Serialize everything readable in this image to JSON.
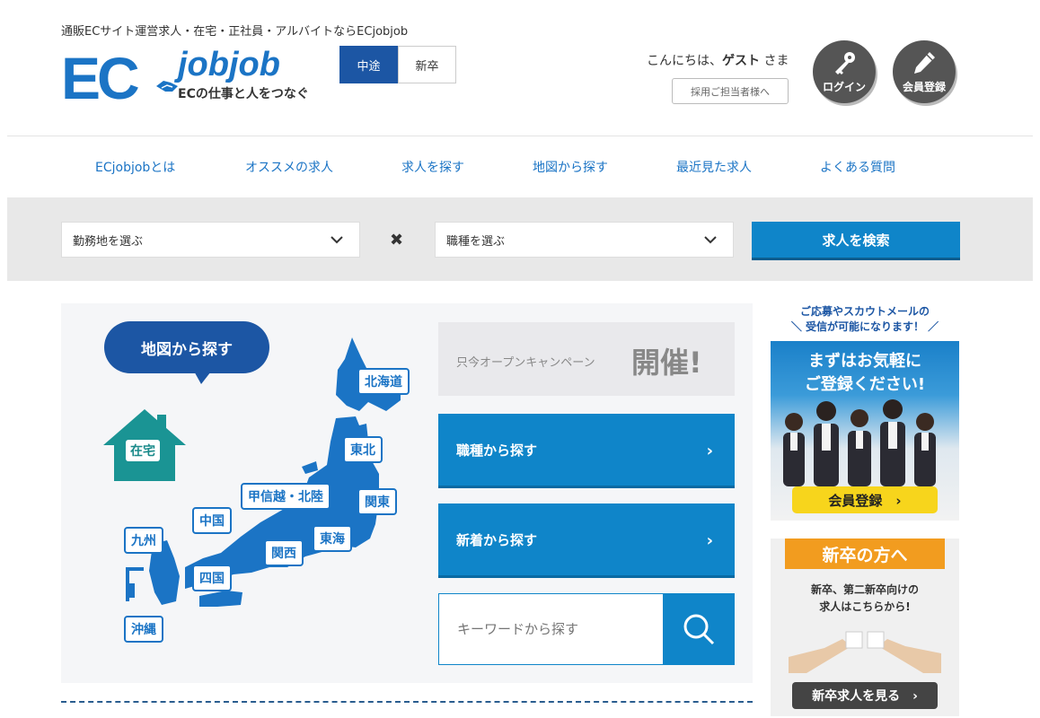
{
  "header": {
    "tagline": "通販ECサイト運営求人・在宅・正社員・アルバイトならECjobjob",
    "logo_ec": "EC",
    "logo_jobjob": "jobjob",
    "logo_sub": "ECの仕事と人をつなぐ",
    "segments": [
      "中途",
      "新卒"
    ],
    "greeting_prefix": "こんにちは、",
    "greeting_user": "ゲスト",
    "greeting_suffix": " さま",
    "recruiter_link": "採用ご担当者様へ",
    "login_label": "ログイン",
    "register_label": "会員登録"
  },
  "nav": {
    "items": [
      "ECjobjobとは",
      "オススメの求人",
      "求人を探す",
      "地図から探す",
      "最近見た求人",
      "よくある質問"
    ]
  },
  "search": {
    "location_select": "勤務地を選ぶ",
    "times": "✖",
    "job_select": "職種を選ぶ",
    "button": "求人を検索"
  },
  "map": {
    "bubble": "地図から探す",
    "home": "在宅",
    "regions": [
      "北海道",
      "東北",
      "甲信越・北陸",
      "関東",
      "中国",
      "東海",
      "九州",
      "関西",
      "四国",
      "沖縄"
    ]
  },
  "main": {
    "campaign_small": "只今オープンキャンペーン",
    "campaign_big": "開催!",
    "by_job": "職種から探す",
    "by_new": "新着から探す",
    "keyword_placeholder": "キーワードから探す",
    "arrow": "›"
  },
  "sidebar": {
    "note_line1": "ご応募やスカウトメールの",
    "note_line2": "＼ 受信が可能になります！ ／",
    "banner1_line1": "まずはお気軽に",
    "banner1_line2": "ご登録ください!",
    "banner1_button": "会員登録　›",
    "banner2_ribbon": "新卒の方へ",
    "banner2_line1": "新卒、第二新卒向けの",
    "banner2_line2": "求人はこちらから!",
    "banner2_button": "新卒求人を見る　›"
  },
  "colors": {
    "brand_blue": "#1b74c5",
    "button_blue": "#0f85c9",
    "dark_blue": "#1c56a4",
    "orange": "#f29c1f",
    "yellow": "#f7d51c"
  }
}
